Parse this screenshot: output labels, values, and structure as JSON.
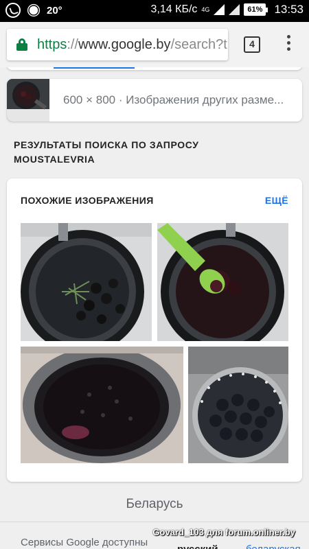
{
  "status_bar": {
    "temperature": "20°",
    "speed": "3,14 КБ/с",
    "network": "4G",
    "battery": "61%",
    "time": "13:53",
    "icons": [
      "viber-icon",
      "weather-sun-icon",
      "signal-icon",
      "signal-icon",
      "battery-icon"
    ]
  },
  "browser": {
    "url_scheme": "https",
    "url_separator": "://",
    "url_host": "www.google.by",
    "url_path": "/search?tbs",
    "tab_count": "4",
    "colors": {
      "secure": "#0b8043"
    }
  },
  "size_card": {
    "text": "600 × 800 · Изображения других разме..."
  },
  "results_heading": "РЕЗУЛЬТАТЫ ПОИСКА ПО ЗАПРОСУ MOUSTALEVRIA",
  "similar": {
    "title": "ПОХОЖИЕ ИЗОБРАЖЕНИЯ",
    "more": "ЕЩЁ",
    "images": [
      "blackberries-in-pot",
      "stirring-berries-spatula",
      "boiling-syrup-pot",
      "blackberries-in-colander"
    ]
  },
  "footer": {
    "country": "Беларусь",
    "services_text": "Сервисы Google доступны",
    "lang_current": "русский",
    "lang_other": "беларуская"
  },
  "watermark": "Govard_103 для forum.onliner.by",
  "accent_color": "#1a73e8"
}
